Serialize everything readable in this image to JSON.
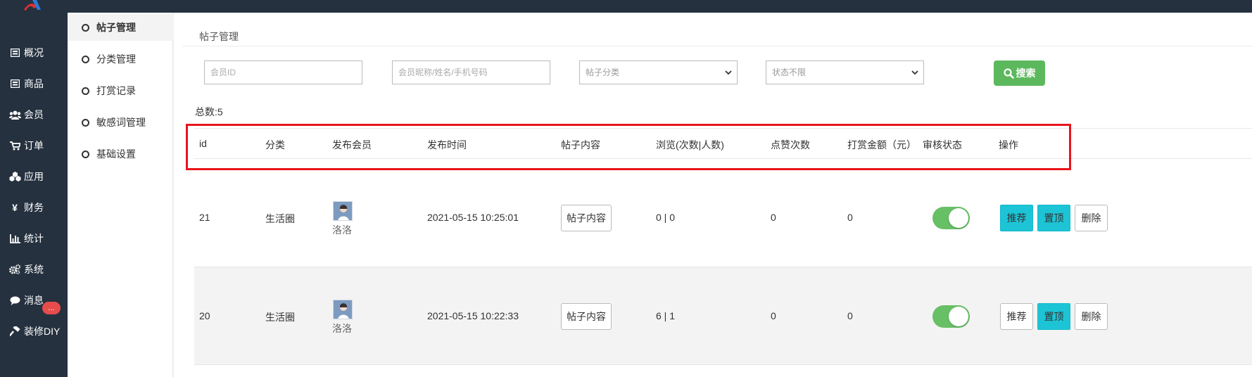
{
  "colors": {
    "sidebar_bg": "#25313f",
    "search_green": "#5cb85c",
    "toggle_green": "#67c065",
    "cyan_button": "#1cc4d6",
    "badge_red": "#e64c4c",
    "highlight_red": "#e8151c"
  },
  "sidebar": {
    "items": [
      {
        "label": "概况",
        "icon": "overview-icon"
      },
      {
        "label": "商品",
        "icon": "goods-icon"
      },
      {
        "label": "会员",
        "icon": "members-icon"
      },
      {
        "label": "订单",
        "icon": "cart-icon"
      },
      {
        "label": "应用",
        "icon": "apps-icon"
      },
      {
        "label": "财务",
        "icon": "yen-icon"
      },
      {
        "label": "统计",
        "icon": "bar-chart-icon"
      },
      {
        "label": "系统",
        "icon": "gears-icon"
      },
      {
        "label": "消息",
        "icon": "chat-icon"
      },
      {
        "label": "装修DIY",
        "icon": "hammer-icon"
      }
    ],
    "message_badge": "..."
  },
  "subnav": {
    "items": [
      {
        "label": "帖子管理",
        "active": true
      },
      {
        "label": "分类管理",
        "active": false
      },
      {
        "label": "打赏记录",
        "active": false
      },
      {
        "label": "敏感词管理",
        "active": false
      },
      {
        "label": "基础设置",
        "active": false
      }
    ]
  },
  "breadcrumb": "帖子管理",
  "filters": {
    "member_id_placeholder": "会员ID",
    "member_info_placeholder": "会员昵称/姓名/手机号码",
    "category_selected": "帖子分类",
    "status_selected": "状态不限",
    "search_label": "搜索"
  },
  "total": "总数:5",
  "table": {
    "headers": [
      "id",
      "分类",
      "发布会员",
      "发布时间",
      "帖子内容",
      "浏览(次数|人数)",
      "点赞次数",
      "打赏金额（元）",
      "审核状态",
      "操作"
    ],
    "rows": [
      {
        "id": "21",
        "category": "生活圈",
        "member": "洛洛",
        "time": "2021-05-15 10:25:01",
        "content_label": "帖子内容",
        "views": "0 | 0",
        "likes": "0",
        "reward": "0",
        "approved": true,
        "recommend_label": "推荐",
        "recommend_on": true,
        "top_label": "置顶",
        "delete_label": "删除"
      },
      {
        "id": "20",
        "category": "生活圈",
        "member": "洛洛",
        "time": "2021-05-15 10:22:33",
        "content_label": "帖子内容",
        "views": "6 | 1",
        "likes": "0",
        "reward": "0",
        "approved": true,
        "recommend_label": "推荐",
        "recommend_on": false,
        "top_label": "置顶",
        "delete_label": "删除"
      }
    ]
  }
}
